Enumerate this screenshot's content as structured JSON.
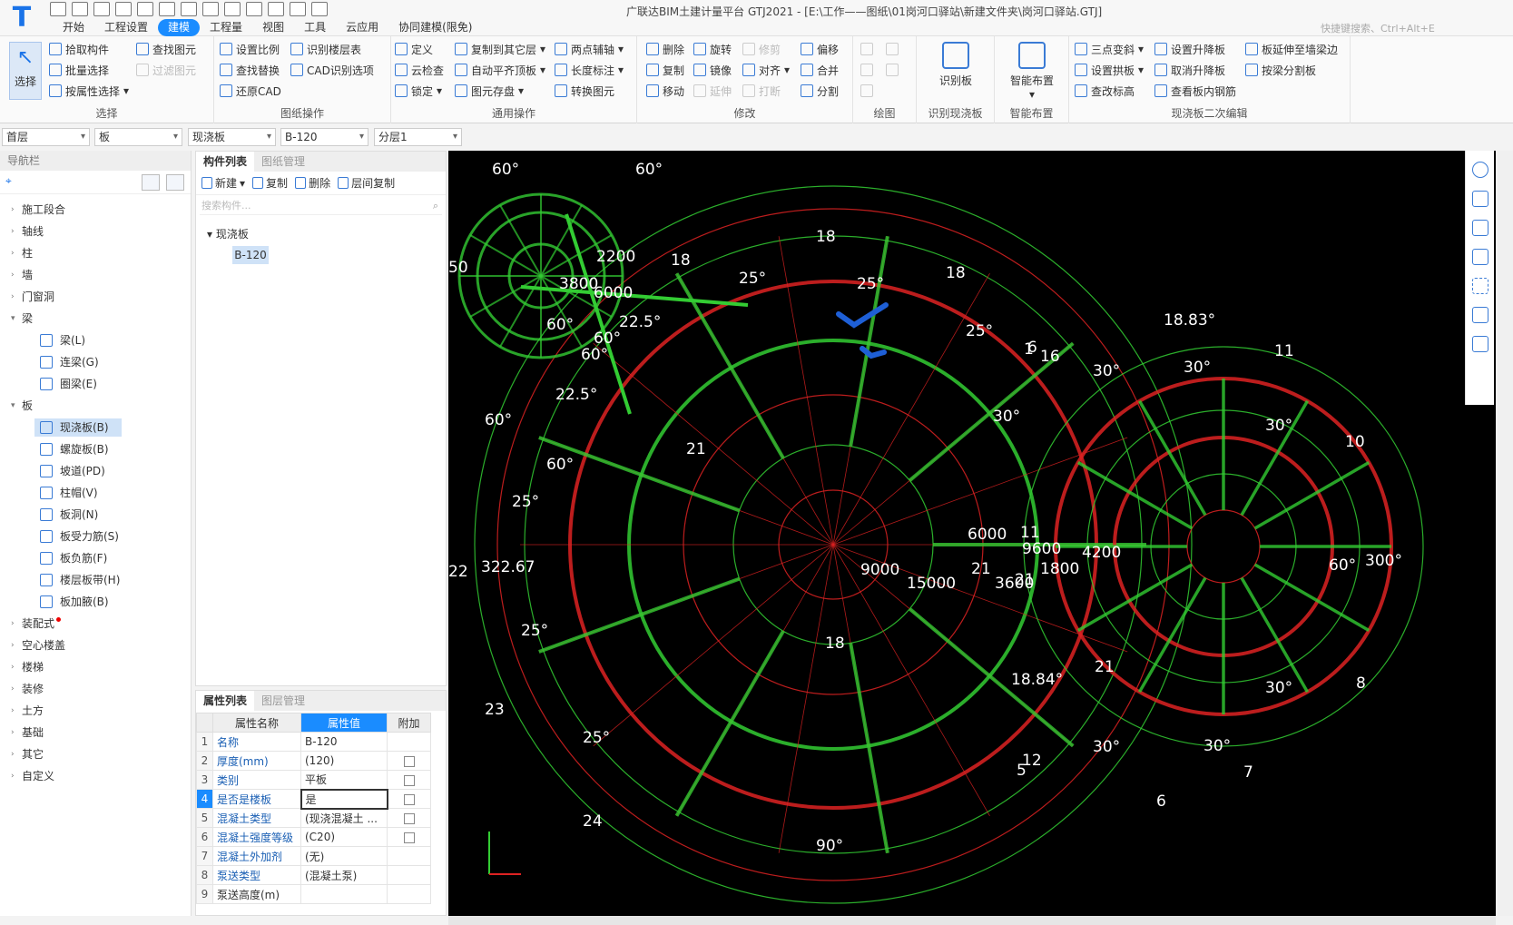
{
  "window": {
    "title": "广联达BIM土建计量平台 GTJ2021 - [E:\\工作——图纸\\01岗河口驿站\\新建文件夹\\岗河口驿站.GTJ]",
    "logo": "T"
  },
  "menu": {
    "tabs": [
      "开始",
      "工程设置",
      "建模",
      "工程量",
      "视图",
      "工具",
      "云应用",
      "协同建模(限免)"
    ],
    "active": "建模"
  },
  "shortcut_search": {
    "placeholder": "快捷键搜索、Ctrl+Alt+E"
  },
  "ribbon": {
    "select_group": {
      "label": "选择",
      "big_button": "选择",
      "items": [
        "拾取构件",
        "批量选择",
        "按属性选择",
        "查找图元",
        "过滤图元"
      ]
    },
    "drawing_ops": {
      "label": "图纸操作",
      "items": [
        "设置比例",
        "查找替换",
        "还原CAD",
        "识别楼层表",
        "CAD识别选项"
      ]
    },
    "general_ops": {
      "label": "通用操作",
      "items": [
        "定义",
        "云检查",
        "锁定",
        "复制到其它层",
        "自动平齐顶板",
        "图元存盘",
        "两点辅轴",
        "长度标注",
        "转换图元"
      ]
    },
    "modify": {
      "label": "修改",
      "items": [
        "删除",
        "复制",
        "移动",
        "旋转",
        "镜像",
        "延伸",
        "修剪",
        "对齐",
        "打断",
        "偏移",
        "合并",
        "分割"
      ]
    },
    "draw": {
      "label": "绘图"
    },
    "recognize": {
      "label": "识别现浇板",
      "button": "识别板"
    },
    "smart": {
      "label": "智能布置",
      "button": "智能布置"
    },
    "secondary_edit": {
      "label": "现浇板二次编辑",
      "items": [
        "三点变斜",
        "设置拱板",
        "查改标高",
        "设置升降板",
        "取消升降板",
        "查看板内钢筋",
        "板延伸至墙梁边",
        "按梁分割板"
      ]
    }
  },
  "layer_selectors": {
    "floor": "首层",
    "category": "板",
    "type": "现浇板",
    "component": "B-120",
    "sublayer": "分层1"
  },
  "nav": {
    "title": "导航栏",
    "tree": [
      {
        "label": "施工段合",
        "kind": "group",
        "expanded": false
      },
      {
        "label": "轴线",
        "kind": "group",
        "expanded": false
      },
      {
        "label": "柱",
        "kind": "group",
        "expanded": false
      },
      {
        "label": "墙",
        "kind": "group",
        "expanded": false
      },
      {
        "label": "门窗洞",
        "kind": "group",
        "expanded": false
      },
      {
        "label": "梁",
        "kind": "group",
        "expanded": true
      },
      {
        "label": "梁(L)",
        "kind": "child"
      },
      {
        "label": "连梁(G)",
        "kind": "child"
      },
      {
        "label": "圈梁(E)",
        "kind": "child"
      },
      {
        "label": "板",
        "kind": "group",
        "expanded": true
      },
      {
        "label": "现浇板(B)",
        "kind": "child",
        "selected": true
      },
      {
        "label": "螺旋板(B)",
        "kind": "child"
      },
      {
        "label": "坡道(PD)",
        "kind": "child"
      },
      {
        "label": "柱帽(V)",
        "kind": "child"
      },
      {
        "label": "板洞(N)",
        "kind": "child"
      },
      {
        "label": "板受力筋(S)",
        "kind": "child"
      },
      {
        "label": "板负筋(F)",
        "kind": "child"
      },
      {
        "label": "楼层板带(H)",
        "kind": "child"
      },
      {
        "label": "板加腋(B)",
        "kind": "child"
      },
      {
        "label": "装配式",
        "kind": "group",
        "expanded": false,
        "badge": true
      },
      {
        "label": "空心楼盖",
        "kind": "group",
        "expanded": false
      },
      {
        "label": "楼梯",
        "kind": "group",
        "expanded": false
      },
      {
        "label": "装修",
        "kind": "group",
        "expanded": false
      },
      {
        "label": "土方",
        "kind": "group",
        "expanded": false
      },
      {
        "label": "基础",
        "kind": "group",
        "expanded": false
      },
      {
        "label": "其它",
        "kind": "group",
        "expanded": false
      },
      {
        "label": "自定义",
        "kind": "group",
        "expanded": false
      }
    ]
  },
  "component_panel": {
    "tabs": [
      "构件列表",
      "图纸管理"
    ],
    "toolbar": [
      "新建",
      "复制",
      "删除",
      "层间复制"
    ],
    "search_placeholder": "搜索构件...",
    "root": "现浇板",
    "item": "B-120"
  },
  "property_panel": {
    "tabs": [
      "属性列表",
      "图层管理"
    ],
    "headers": [
      "属性名称",
      "属性值",
      "附加"
    ],
    "rows": [
      {
        "n": "1",
        "name": "名称",
        "value": "B-120",
        "check": false
      },
      {
        "n": "2",
        "name": "厚度(mm)",
        "value": "(120)",
        "check": true
      },
      {
        "n": "3",
        "name": "类别",
        "value": "平板",
        "check": true
      },
      {
        "n": "4",
        "name": "是否是楼板",
        "value": "是",
        "check": true,
        "current": true
      },
      {
        "n": "5",
        "name": "混凝土类型",
        "value": "(现浇混凝土 ...",
        "check": true
      },
      {
        "n": "6",
        "name": "混凝土强度等级",
        "value": "(C20)",
        "check": true
      },
      {
        "n": "7",
        "name": "混凝土外加剂",
        "value": "(无)",
        "check": false
      },
      {
        "n": "8",
        "name": "泵送类型",
        "value": "(混凝土泵)",
        "check": false
      },
      {
        "n": "9",
        "name": "泵送高度(m)",
        "value": "",
        "check": false
      }
    ]
  },
  "cad": {
    "labels": [
      "60°",
      "60°",
      "60°",
      "60°",
      "60°",
      "60°",
      "60°",
      "50",
      "2200",
      "3800",
      "6000",
      "22.5°",
      "22.5°",
      "18",
      "18",
      "18",
      "18",
      "25°",
      "25°",
      "25°",
      "25°",
      "25°",
      "25°",
      "21",
      "21",
      "21",
      "21",
      "22",
      "23",
      "24",
      "322.67",
      "90°",
      "15000",
      "9000",
      "6000",
      "3600",
      "9600",
      "1800",
      "4200",
      "11",
      "16",
      "30°",
      "30°",
      "30°",
      "30°",
      "30°",
      "30°",
      "30°",
      "18.84°",
      "18.83°",
      "6",
      "6",
      "11",
      "10",
      "8",
      "7",
      "12",
      "5",
      "1",
      "300°",
      "60°"
    ],
    "colors": {
      "green": "#33cc33",
      "red": "#dd2222",
      "white": "#ffffff",
      "check_mark": "#1e5fd6"
    }
  }
}
